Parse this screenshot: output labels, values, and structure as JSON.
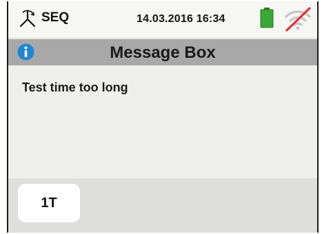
{
  "statusbar": {
    "mode_icon": "phase-sequence-icon",
    "mode_label": "SEQ",
    "datetime": "14.03.2016  16:34",
    "battery_icon": "battery-icon",
    "wifi_icon": "wifi-disabled-icon"
  },
  "titlebar": {
    "icon": "info-icon",
    "title": "Message Box"
  },
  "message": {
    "text": "Test time too long"
  },
  "softkeys": {
    "key1_label": "1T"
  },
  "colors": {
    "battery": "#3aa832",
    "info": "#1f86d6",
    "wifi_slash": "#e53030"
  }
}
